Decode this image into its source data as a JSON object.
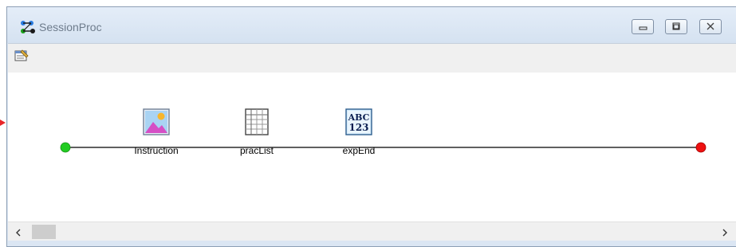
{
  "window": {
    "title": "SessionProc",
    "controls": {
      "minimize": "minimize-icon",
      "maximize": "maximize-icon",
      "close": "close-icon"
    }
  },
  "toolbar": {
    "items": [
      {
        "icon": "properties-icon"
      }
    ]
  },
  "timeline": {
    "start_color": "#22cc22",
    "end_color": "#ee1111",
    "objects": [
      {
        "label": "Instruction",
        "icon": "image-display-icon"
      },
      {
        "label": "pracList",
        "icon": "list-table-icon"
      },
      {
        "label": "expEnd",
        "icon": "text-display-icon"
      }
    ]
  },
  "colors": {
    "window_frame": "#dbe6f3",
    "title_text": "#6e7c8c",
    "red_marker": "#e8262a"
  }
}
